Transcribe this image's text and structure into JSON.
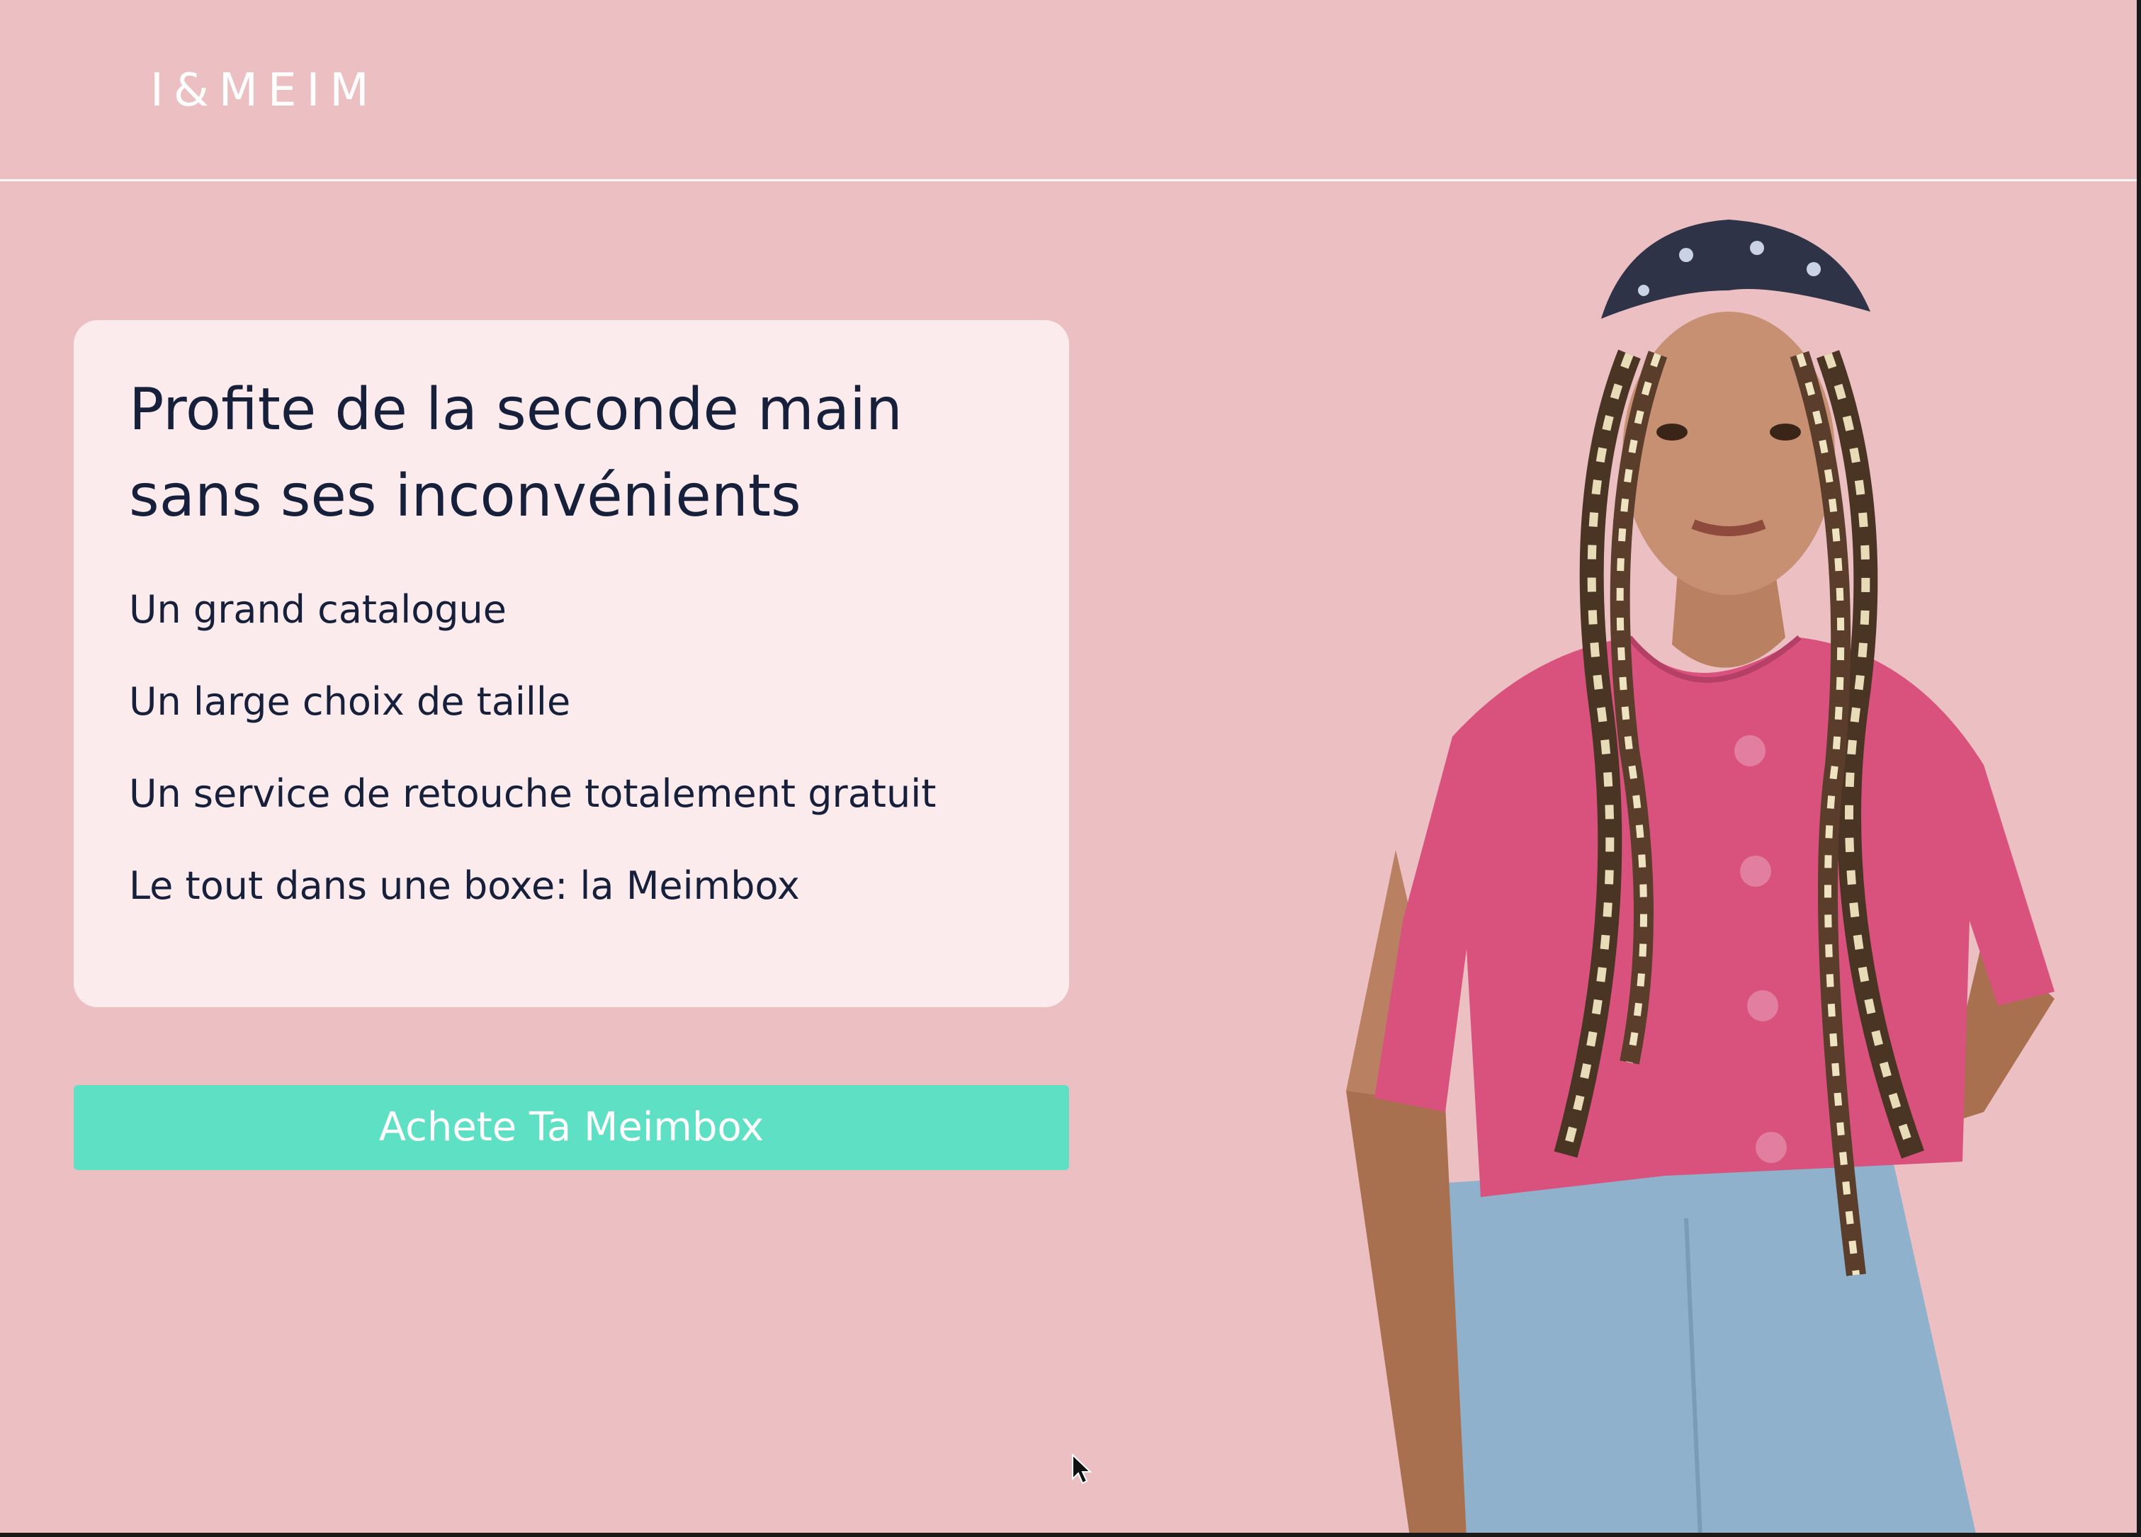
{
  "header": {
    "logo_text": "I&MEIM"
  },
  "hero_card": {
    "title": "Profite de la seconde main sans ses inconvénients",
    "features": [
      "Un grand catalogue",
      "Un large choix de taille",
      "Un service de retouche totalement gratuit",
      "Le tout dans une boxe: la Meimbox"
    ]
  },
  "cta": {
    "label": "Achete Ta Meimbox"
  },
  "colors": {
    "background": "#ecc0c3",
    "card": "#fcebed",
    "text": "#17203a",
    "cta": "#5de0c4",
    "shirt": "#d8527d",
    "pants": "#8fb1cc",
    "bandana": "#2f3348"
  },
  "icons": {
    "cursor": "mouse-pointer-icon"
  }
}
